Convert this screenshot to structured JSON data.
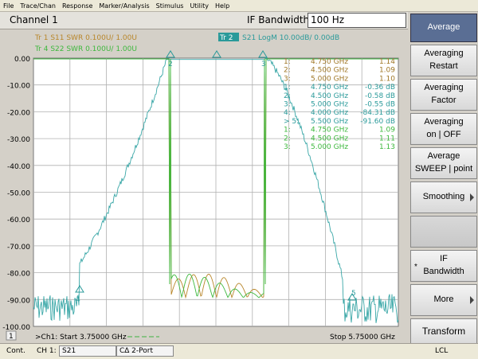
{
  "menu": [
    "File",
    "Trace/Chan",
    "Response",
    "Marker/Analysis",
    "Stimulus",
    "Utility",
    "Help"
  ],
  "channel_title": "Channel 1",
  "ifbw": {
    "label": "IF Bandwidth",
    "value": "100 Hz"
  },
  "traces": [
    {
      "text": "Tr  1  S11 SWR 0.100U/  1.00U",
      "color": "#b8862a"
    },
    {
      "text": "Tr  4  S22 SWR 0.100U/  1.00U",
      "color": "#3db83d"
    },
    {
      "badge": "Tr  2",
      "text": "S21 LogM 10.00dB/  0.00dB",
      "color": "#2a9a9a"
    }
  ],
  "y_ticks": [
    "0.00",
    "-10.00",
    "-20.00",
    "-30.00",
    "-40.00",
    "-50.00",
    "-60.00",
    "-70.00",
    "-80.00",
    "-90.00",
    "-100.00"
  ],
  "markers": [
    {
      "id": "1:",
      "freq": "4.750 GHz",
      "val": "1.14",
      "color": "#a07828"
    },
    {
      "id": "2:",
      "freq": "4.500 GHz",
      "val": "1.09",
      "color": "#a07828"
    },
    {
      "id": "3:",
      "freq": "5.000 GHz",
      "val": "1.10",
      "color": "#a07828"
    },
    {
      "id": "1:",
      "freq": "4.750 GHz",
      "val": "-0.36 dB",
      "color": "#2a9a9a"
    },
    {
      "id": "2:",
      "freq": "4.500 GHz",
      "val": "-0.58 dB",
      "color": "#2a9a9a"
    },
    {
      "id": "3:",
      "freq": "5.000 GHz",
      "val": "-0.55 dB",
      "color": "#2a9a9a"
    },
    {
      "id": "4:",
      "freq": "4.000 GHz",
      "val": "-84.31 dB",
      "color": "#2a9a9a"
    },
    {
      "id": "> 5:",
      "freq": "5.500 GHz",
      "val": "-91.60 dB",
      "color": "#2a9a9a"
    },
    {
      "id": "1:",
      "freq": "4.750 GHz",
      "val": "1.09",
      "color": "#3db83d"
    },
    {
      "id": "2:",
      "freq": "4.500 GHz",
      "val": "1.11",
      "color": "#3db83d"
    },
    {
      "id": "3:",
      "freq": "5.000 GHz",
      "val": "1.13",
      "color": "#3db83d"
    }
  ],
  "plot_marker_labels": {
    "m2": "2",
    "m3": "3",
    "m4": "4",
    "m5": "5"
  },
  "footer": {
    "num": "1",
    "start": ">Ch1: Start  3.75000 GHz",
    "stop": "Stop  5.75000 GHz"
  },
  "softkeys": {
    "averaging": "Average",
    "restart_1": "Averaging",
    "restart_2": "Restart",
    "factor_1": "Averaging",
    "factor_2": "Factor",
    "onoff_1": "Averaging",
    "onoff_2": "on | OFF",
    "sweep_1": "Average",
    "sweep_2": "SWEEP | point",
    "smoothing": "Smoothing",
    "ifbw_1": "IF",
    "ifbw_2": "Bandwidth",
    "ifbw_star": "*",
    "more": "More",
    "transform": "Transform"
  },
  "status": {
    "cont": "Cont.",
    "ch": "CH 1:",
    "param": "S21",
    "port": "C∆ 2-Port",
    "lcl": "LCL"
  },
  "colors": {
    "s11": "#b8862a",
    "s21": "#3aa7a7",
    "s22": "#3db83d",
    "grid": "#a8a8a8"
  }
}
